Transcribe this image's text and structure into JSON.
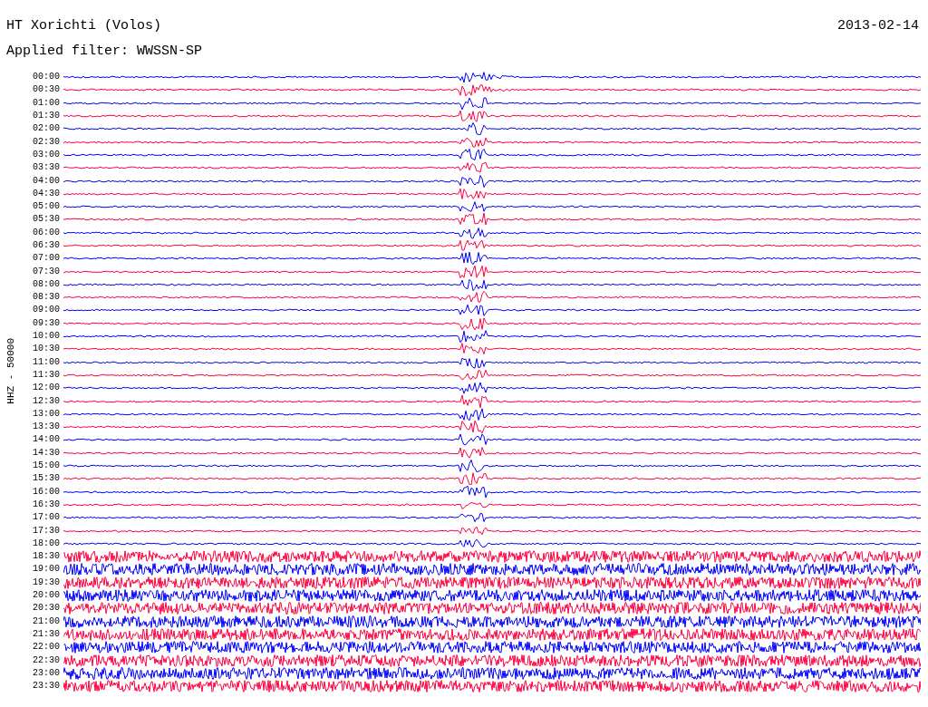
{
  "title": "HT Xorichti (Volos)",
  "date": "2013-02-14",
  "filter": "Applied filter: WWSSN-SP",
  "channel_label": "HHZ - 50000",
  "traces": [
    {
      "time": "00:00",
      "color": "#0000ff"
    },
    {
      "time": "00:30",
      "color": "#ff0040"
    },
    {
      "time": "01:00",
      "color": "#0000ff"
    },
    {
      "time": "01:30",
      "color": "#ff0040"
    },
    {
      "time": "02:00",
      "color": "#0000ff"
    },
    {
      "time": "02:30",
      "color": "#ff0040"
    },
    {
      "time": "03:00",
      "color": "#0000ff"
    },
    {
      "time": "03:30",
      "color": "#ff0040"
    },
    {
      "time": "04:00",
      "color": "#0000ff"
    },
    {
      "time": "04:30",
      "color": "#ff0040"
    },
    {
      "time": "05:00",
      "color": "#0000ff"
    },
    {
      "time": "05:30",
      "color": "#ff0040"
    },
    {
      "time": "06:00",
      "color": "#0000ff"
    },
    {
      "time": "06:30",
      "color": "#ff0040"
    },
    {
      "time": "07:00",
      "color": "#0000ff"
    },
    {
      "time": "07:30",
      "color": "#ff0040"
    },
    {
      "time": "08:00",
      "color": "#0000ff"
    },
    {
      "time": "08:30",
      "color": "#ff0040"
    },
    {
      "time": "09:00",
      "color": "#0000ff"
    },
    {
      "time": "09:30",
      "color": "#ff0040"
    },
    {
      "time": "10:00",
      "color": "#0000ff"
    },
    {
      "time": "10:30",
      "color": "#ff0040"
    },
    {
      "time": "11:00",
      "color": "#0000ff"
    },
    {
      "time": "11:30",
      "color": "#ff0040"
    },
    {
      "time": "12:00",
      "color": "#0000ff"
    },
    {
      "time": "12:30",
      "color": "#ff0040"
    },
    {
      "time": "13:00",
      "color": "#0000ff"
    },
    {
      "time": "13:30",
      "color": "#ff0040"
    },
    {
      "time": "14:00",
      "color": "#0000ff"
    },
    {
      "time": "14:30",
      "color": "#ff0040"
    },
    {
      "time": "15:00",
      "color": "#0000ff"
    },
    {
      "time": "15:30",
      "color": "#ff0040"
    },
    {
      "time": "16:00",
      "color": "#0000ff"
    },
    {
      "time": "16:30",
      "color": "#ff0040"
    },
    {
      "time": "17:00",
      "color": "#0000ff"
    },
    {
      "time": "17:30",
      "color": "#ff0040"
    },
    {
      "time": "18:00",
      "color": "#0000ff"
    },
    {
      "time": "18:30",
      "color": "#ff0040"
    },
    {
      "time": "19:00",
      "color": "#0000ff"
    },
    {
      "time": "19:30",
      "color": "#ff0040"
    },
    {
      "time": "20:00",
      "color": "#0000ff"
    },
    {
      "time": "20:30",
      "color": "#ff0040"
    },
    {
      "time": "21:00",
      "color": "#0000ff"
    },
    {
      "time": "21:30",
      "color": "#ff0040"
    },
    {
      "time": "22:00",
      "color": "#0000ff"
    },
    {
      "time": "22:30",
      "color": "#ff0040"
    },
    {
      "time": "23:00",
      "color": "#0000ff"
    },
    {
      "time": "23:30",
      "color": "#ff0040"
    }
  ]
}
